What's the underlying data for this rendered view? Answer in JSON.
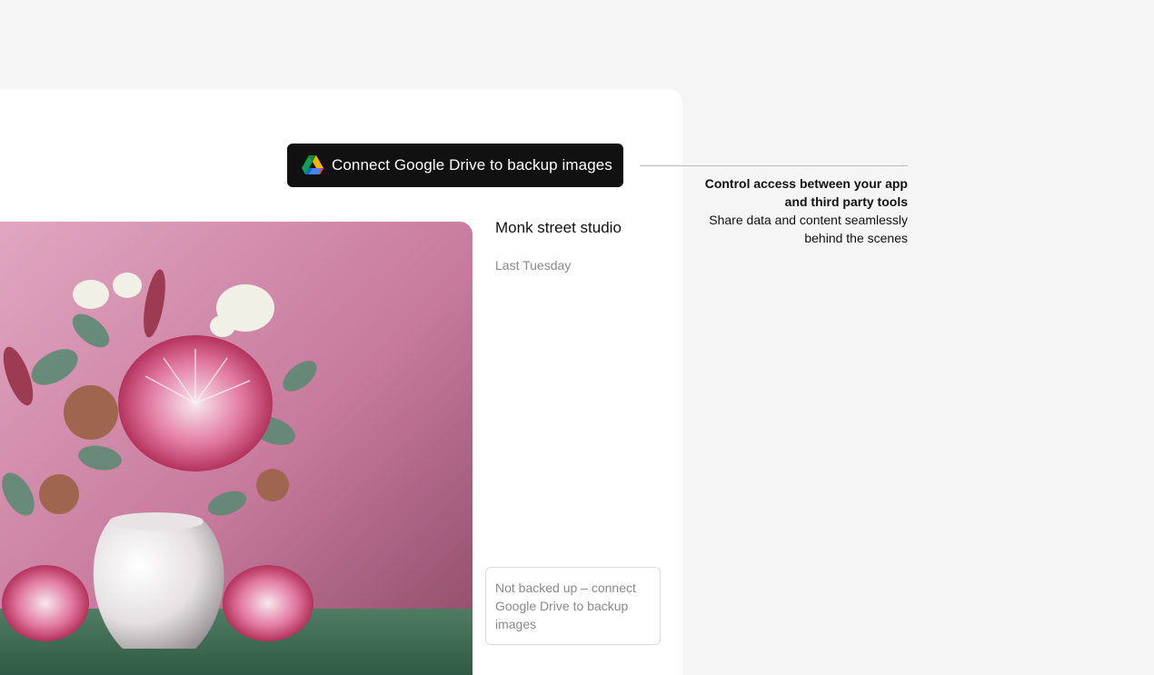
{
  "connect_button": {
    "label": "Connect Google Drive to backup images",
    "icon": "google-drive-icon"
  },
  "item": {
    "title": "Monk street studio",
    "date": "Last Tuesday",
    "backup_status": "Not backed up – connect Google Drive to backup images"
  },
  "callout": {
    "heading": "Control access between your app and third party tools",
    "body": "Share data and content seamlessly behind the scenes"
  },
  "colors": {
    "background": "#f5f5f5",
    "card": "#ffffff",
    "button": "#111111",
    "muted_text": "#8a8a8a",
    "drive_green": "#0f9d58",
    "drive_yellow": "#f4b400",
    "drive_blue": "#4285f4"
  }
}
